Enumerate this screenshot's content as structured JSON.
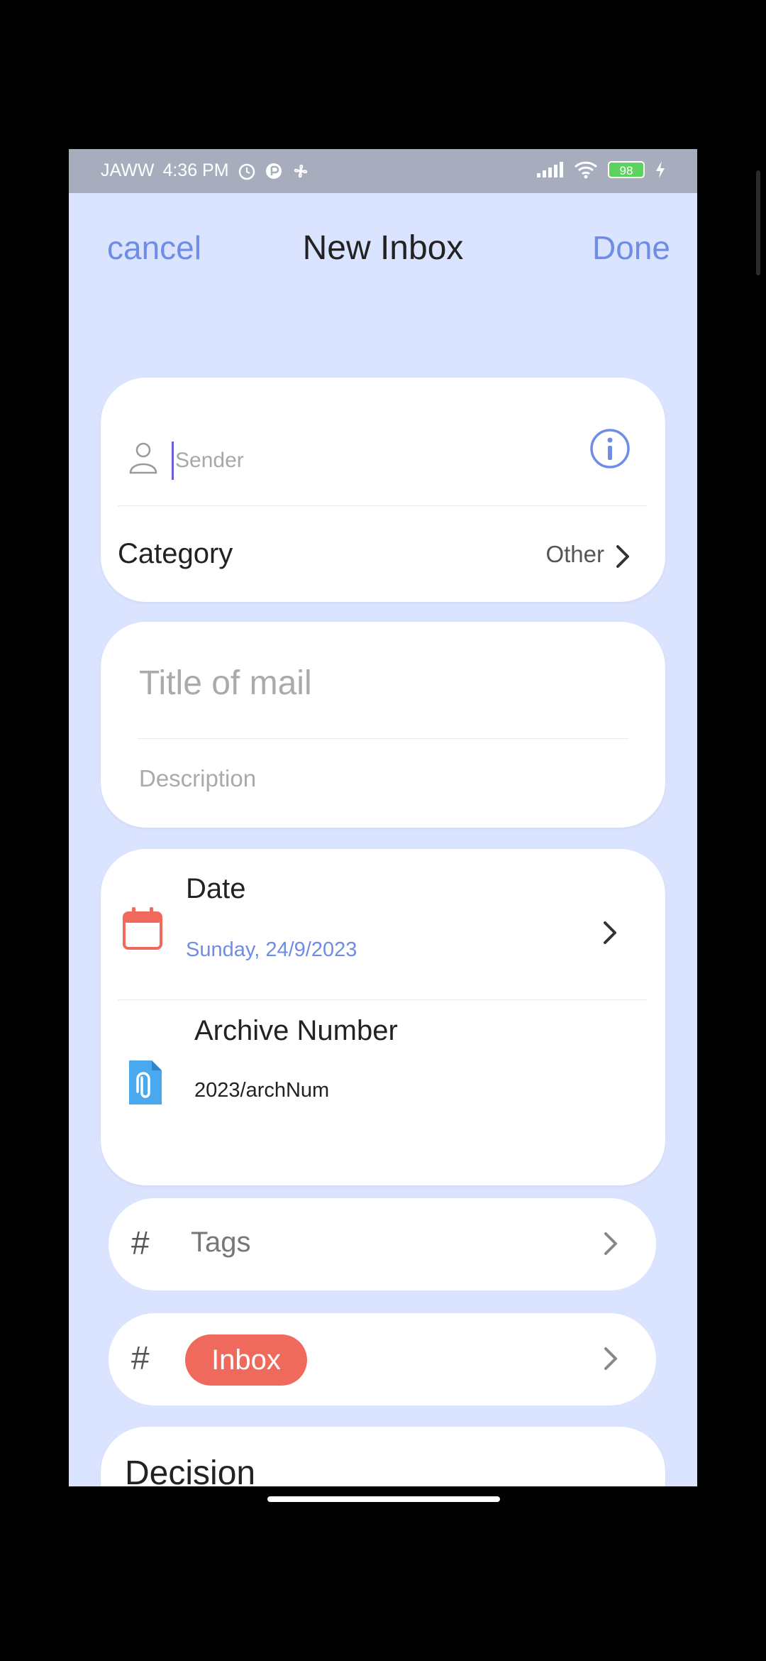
{
  "status_bar": {
    "carrier": "JAWW",
    "time": "4:36 PM",
    "battery": "98",
    "icons": [
      "alarm-icon",
      "app-icon",
      "fan-icon",
      "signal-icon",
      "wifi-icon",
      "battery-icon",
      "charging-icon"
    ]
  },
  "navbar": {
    "cancel_label": "cancel",
    "title": "New Inbox",
    "done_label": "Done"
  },
  "sender": {
    "placeholder": "Sender",
    "value": ""
  },
  "category": {
    "label": "Category",
    "value": "Other"
  },
  "mail": {
    "title_placeholder": "Title of mail",
    "description_placeholder": "Description"
  },
  "date": {
    "label": "Date",
    "value": "Sunday, 24/9/2023"
  },
  "archive": {
    "label": "Archive Number",
    "value": "2023/archNum"
  },
  "tags": {
    "label": "Tags"
  },
  "inbox_chip": {
    "label": "Inbox"
  },
  "decision": {
    "label": "Decision"
  },
  "colors": {
    "background": "#dbe4ff",
    "accent": "#6f8de6",
    "chip": "#ef6a5d",
    "calendar": "#ef6a5d",
    "file_icon": "#4aa8ee"
  }
}
